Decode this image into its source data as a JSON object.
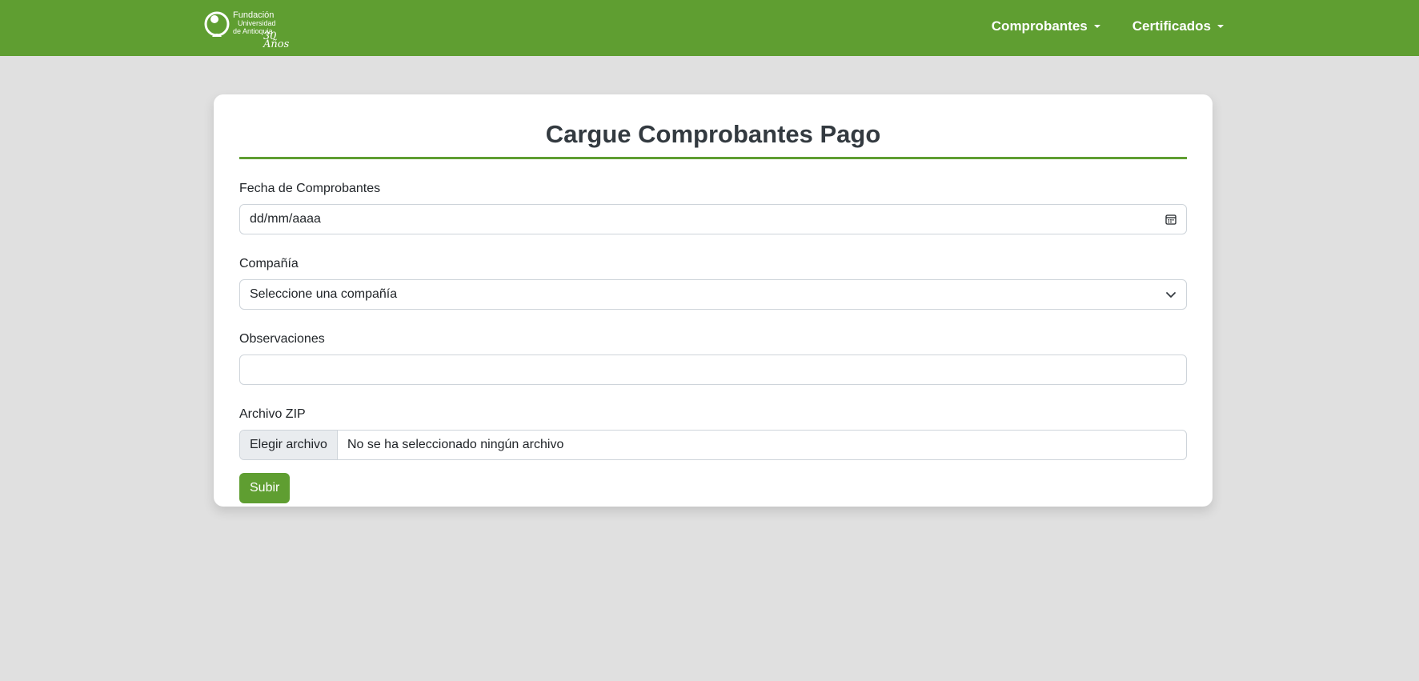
{
  "brand": {
    "line1": "Fundación",
    "line2": "Universidad",
    "line3": "de Antioquia",
    "line4": "30 Años"
  },
  "nav": {
    "items": [
      {
        "label": "Comprobantes"
      },
      {
        "label": "Certificados"
      }
    ]
  },
  "form": {
    "title": "Cargue Comprobantes Pago",
    "date": {
      "label": "Fecha de Comprobantes",
      "placeholder": "dd/mm/aaaa"
    },
    "company": {
      "label": "Compañía",
      "selected": "Seleccione una compañía"
    },
    "notes": {
      "label": "Observaciones",
      "value": ""
    },
    "zip": {
      "label": "Archivo ZIP",
      "button": "Elegir archivo",
      "status": "No se ha seleccionado ningún archivo"
    },
    "submit": "Subir"
  },
  "colors": {
    "brand_green": "#5f9e31",
    "background": "#e0e0e0"
  }
}
